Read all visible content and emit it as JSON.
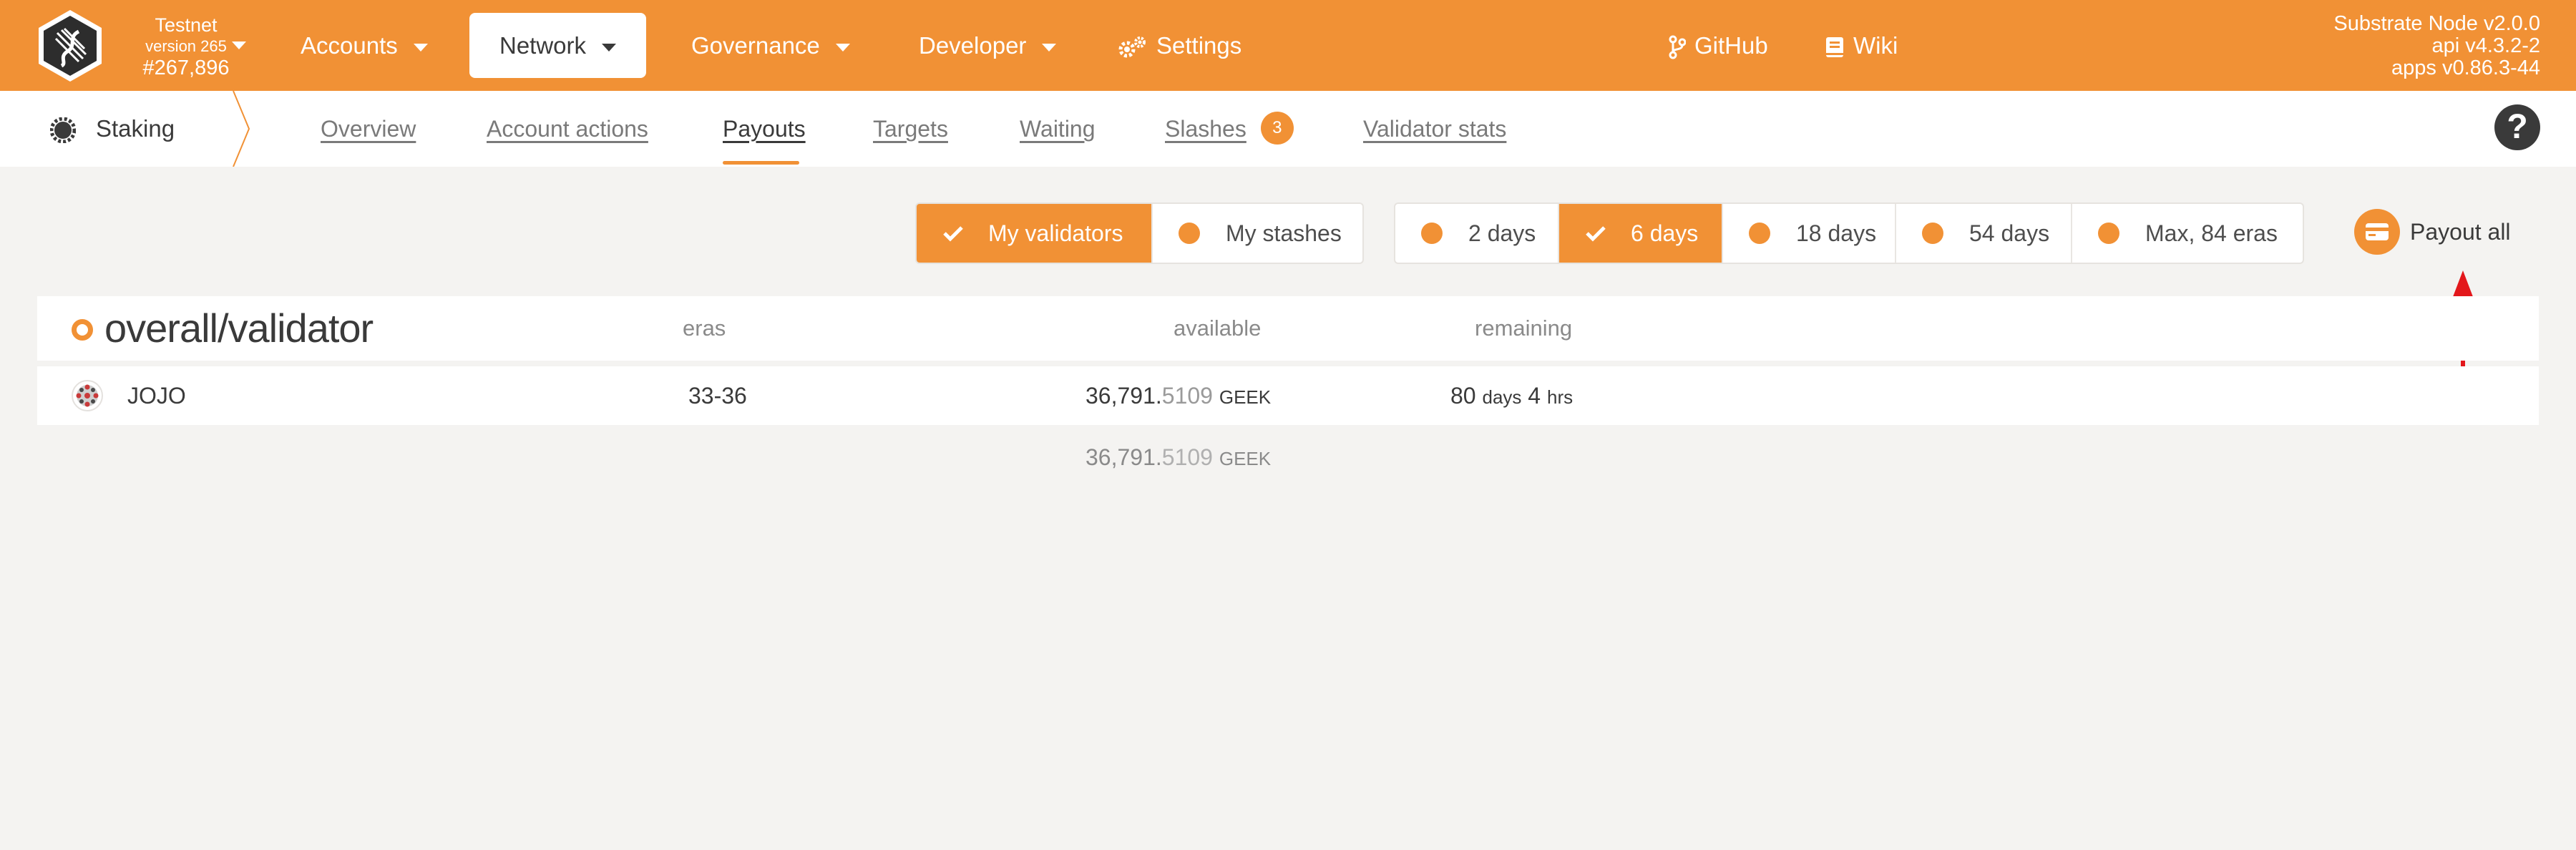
{
  "chain": {
    "name": "Testnet",
    "version": "version 265",
    "block": "#267,896"
  },
  "menu": {
    "accounts": "Accounts",
    "network": "Network",
    "governance": "Governance",
    "developer": "Developer",
    "settings": "Settings",
    "github": "GitHub",
    "wiki": "Wiki"
  },
  "node_info": {
    "node": "Substrate Node v2.0.0",
    "api": "api v4.3.2-2",
    "apps": "apps v0.86.3-44"
  },
  "section": "Staking",
  "tabs": {
    "overview": "Overview",
    "account_actions": "Account actions",
    "payouts": "Payouts",
    "targets": "Targets",
    "waiting": "Waiting",
    "slashes": "Slashes",
    "slashes_badge": "3",
    "validator_stats": "Validator stats"
  },
  "filters": {
    "my_validators": "My validators",
    "my_stashes": "My stashes"
  },
  "periods": {
    "d2": "2 days",
    "d6": "6 days",
    "d18": "18 days",
    "d54": "54 days",
    "max": "Max, 84 eras"
  },
  "payout_all": "Payout all",
  "table": {
    "title": "overall/validator",
    "col_eras": "eras",
    "col_available": "available",
    "col_remaining": "remaining",
    "rows": [
      {
        "name": "JOJO",
        "eras": "33-36",
        "available_int": "36,791.",
        "available_dec": "5109",
        "unit": "GEEK",
        "remaining_days": "80",
        "days_label": "days",
        "remaining_hrs": "4",
        "hrs_label": "hrs"
      }
    ],
    "total_int": "36,791.",
    "total_dec": "5109",
    "total_unit": "GEEK"
  },
  "colors": {
    "accent": "#f19135",
    "dark": "#3a3a3a",
    "background": "#f4f3f1",
    "arrow": "#e3171b"
  }
}
